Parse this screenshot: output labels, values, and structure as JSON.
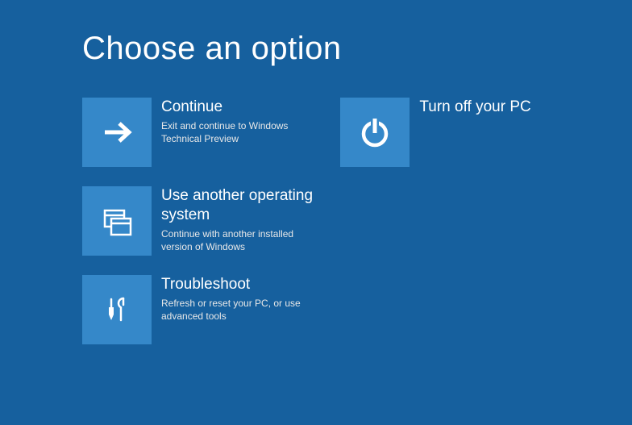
{
  "title": "Choose an option",
  "options": {
    "continue": {
      "title": "Continue",
      "desc": "Exit and continue to Windows Technical Preview"
    },
    "useAnotherOS": {
      "title": "Use another operating system",
      "desc": "Continue with another installed version of Windows"
    },
    "troubleshoot": {
      "title": "Troubleshoot",
      "desc": "Refresh or reset your PC, or use advanced tools"
    },
    "turnOff": {
      "title": "Turn off your PC"
    }
  }
}
